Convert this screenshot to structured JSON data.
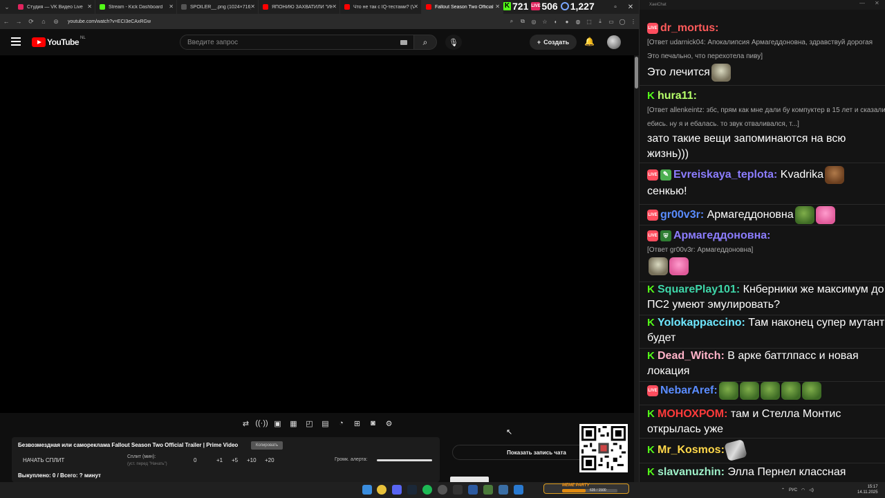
{
  "browser": {
    "tabs": [
      {
        "title": "Студия — VK Видео Live",
        "color": "#e0245e"
      },
      {
        "title": "Stream - Kick Dashboard",
        "color": "#53fc18"
      },
      {
        "title": "SPOILER__.png (1024×716)",
        "color": "#555555"
      },
      {
        "title": "ЯПОНИЮ ЗАХВАТИЛИ \"ИНО",
        "color": "#ff0000"
      },
      {
        "title": "Что не так с IQ-тестами? (Ve",
        "color": "#ff0000"
      },
      {
        "title": "Fallout Season Two Official",
        "color": "#ff0000"
      }
    ],
    "url": "youtube.com/watch?v=ECI3eCAxRGw"
  },
  "stream_stats": {
    "kick": "721",
    "vk": "506",
    "viewers": "1,227"
  },
  "youtube": {
    "logo": "YouTube",
    "region": "NL",
    "search_placeholder": "Введите запрос",
    "create_label": "Создать"
  },
  "panel": {
    "title": "Безвозмездная или самореклама Fallout Season Two Official Trailer | Prime Video",
    "copy_label": "Копировать",
    "start_split": "НАЧАТЬ СПЛИТ",
    "split_label": "Сплит (мин):",
    "split_hint": "(уст. перед \"Начать\")",
    "split_values": [
      "0",
      "+1",
      "+5",
      "+10",
      "+20"
    ],
    "alert_label": "Громк. алерта:",
    "bought": "Выкуплено: 0 / Всего: ? минут",
    "alert_volume": 1.0
  },
  "show_chat": "Показать запись чата",
  "chat": {
    "app_title": "XaeiChat",
    "messages": [
      {
        "name": "dr_mortus",
        "color": "#ff5a5a",
        "badges": [
          "vk"
        ],
        "reply": "[Ответ udarnick04: Апокалипсия Армагеддоновна, здравствуй дорогая Это печально, что перехотела пиву]",
        "text": "Это лечится"
      },
      {
        "name": "hura11",
        "color": "#b6ff6a",
        "badges": [
          "kick"
        ],
        "reply": "[Ответ allenkeintz: збс, прям как мне дали бу компуктер в 15 лет и сказали ебись. ну я и ебалась. то звук отваливался, т...]",
        "text": "зато такие вещи запоминаются на всю жизнь)))"
      },
      {
        "name": "Evreiskaya_teplota",
        "color": "#8c7dff",
        "badges": [
          "vk",
          "sub"
        ],
        "text": "Kvadrika",
        "text2": "сенкью!"
      },
      {
        "name": "gr00v3r",
        "color": "#5a8cff",
        "badges": [
          "vk"
        ],
        "text": "Армагеддоновна"
      },
      {
        "name": "Армагеддоновна",
        "color": "#8c7dff",
        "badges": [
          "vk",
          "shield"
        ],
        "reply": "[Ответ gr00v3r: Армагеддоновна]"
      },
      {
        "name": "SquarePlay101",
        "color": "#3ed6a8",
        "badges": [
          "kick"
        ],
        "text": "Кнберники же максимум до ПС2 умеют эмулировать?"
      },
      {
        "name": "Yolokappaccino",
        "color": "#6fe8ff",
        "badges": [
          "kick"
        ],
        "text": "Там наконец супер мутант будет"
      },
      {
        "name": "Dead_Witch",
        "color": "#ffb3c8",
        "badges": [
          "kick"
        ],
        "text": "В арке баттлпасс и новая локация"
      },
      {
        "name": "NebarAref",
        "color": "#5a8cff",
        "badges": [
          "vk"
        ]
      },
      {
        "name": "МОНОХРОМ",
        "color": "#ff3a3a",
        "badges": [
          "kick"
        ],
        "text": "там и Стелла Монтис открылась уже"
      },
      {
        "name": "Mr_Kosmos",
        "color": "#ffd84a",
        "badges": [
          "kick"
        ]
      },
      {
        "name": "slavanuzhin",
        "color": "#9ef0c8",
        "badges": [
          "kick"
        ],
        "text": "Элла Пернел классная"
      }
    ]
  },
  "taskbar": {
    "lang": "РУС",
    "time": "15:17",
    "date": "14.11.2025",
    "meme_label": "MEME PARTY",
    "meme_value": "635 / 1500",
    "meme_progress": 0.42
  }
}
